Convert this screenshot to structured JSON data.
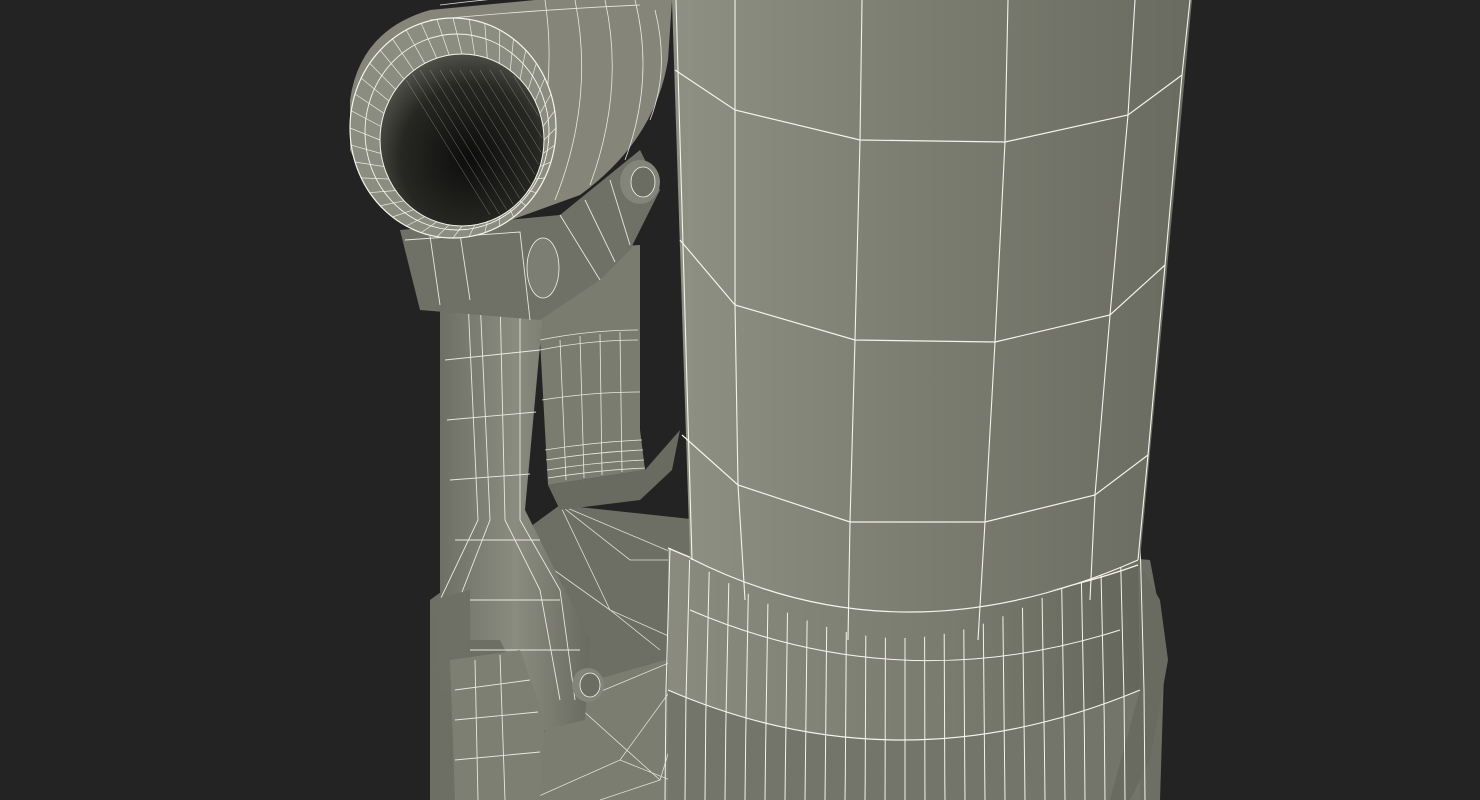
{
  "scene": {
    "subject": "wireframe-render",
    "colors": {
      "background": "#232323",
      "surface_light": "#8a8b7e",
      "surface_mid": "#78796c",
      "surface_dark": "#5e5f55",
      "shadow": "#3f403a",
      "wire": "#f4f4ec"
    }
  }
}
